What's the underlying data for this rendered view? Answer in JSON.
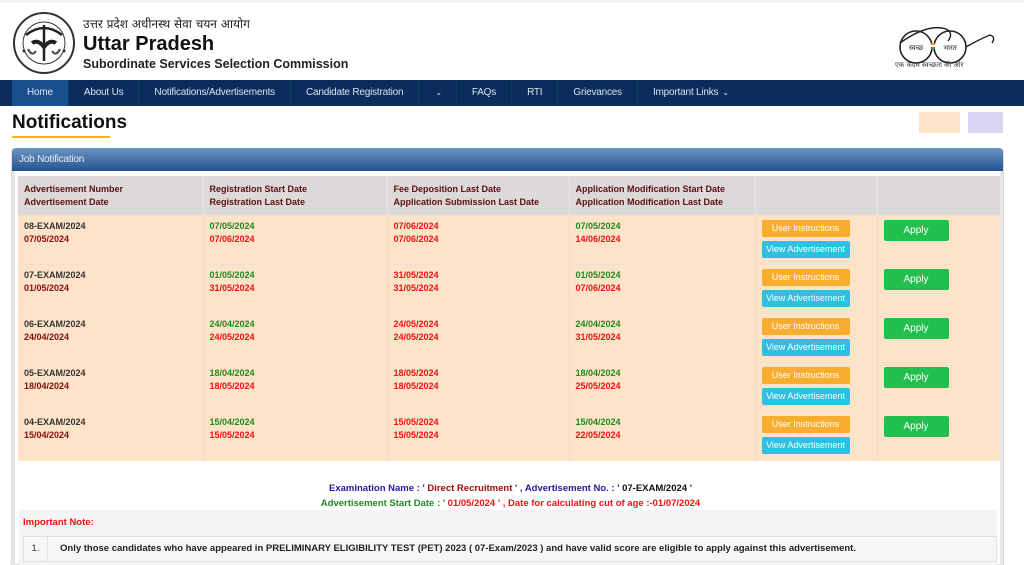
{
  "header": {
    "hindi_title": "उत्तर प्रदेश अधीनस्थ सेवा चयन आयोग",
    "title": "Uttar Pradesh",
    "subtitle": "Subordinate Services Selection Commission",
    "emblem_icon": "up-government-emblem",
    "swachh_logo": {
      "left_text": "स्वच्छ",
      "right_text": "भारत",
      "tagline": "एक कदम स्वच्छता की ओर"
    }
  },
  "nav": {
    "items": [
      {
        "label": "Home",
        "active": true
      },
      {
        "label": "About Us"
      },
      {
        "label": "Notifications/Advertisements"
      },
      {
        "label": "Candidate Registration"
      },
      {
        "label": "",
        "dropdown": true
      },
      {
        "label": "FAQs"
      },
      {
        "label": "RTI"
      },
      {
        "label": "Grievances"
      },
      {
        "label": "Important Links",
        "dropdown": true
      }
    ]
  },
  "page": {
    "title": "Notifications",
    "legend_colors": [
      "#fde3c8",
      "#d8d5f4"
    ]
  },
  "panel": {
    "title": "Job Notification",
    "columns": [
      {
        "line1": "Advertisement Number",
        "line2": "Advertisement Date"
      },
      {
        "line1": "Registration Start Date",
        "line2": "Registration Last Date"
      },
      {
        "line1": "Fee Deposition Last Date",
        "line2": "Application Submission Last Date"
      },
      {
        "line1": "Application Modification Start Date",
        "line2": "Application Modification Last Date"
      },
      {
        "line1": "",
        "line2": ""
      },
      {
        "line1": "",
        "line2": ""
      }
    ],
    "rows": [
      {
        "adv_no": "08-EXAM/2024",
        "adv_date": "07/05/2024",
        "reg_start": "07/05/2024",
        "reg_last": "07/06/2024",
        "fee_last": "07/06/2024",
        "submit_last": "07/06/2024",
        "mod_start": "07/05/2024",
        "mod_last": "14/06/2024"
      },
      {
        "adv_no": "07-EXAM/2024",
        "adv_date": "01/05/2024",
        "reg_start": "01/05/2024",
        "reg_last": "31/05/2024",
        "fee_last": "31/05/2024",
        "submit_last": "31/05/2024",
        "mod_start": "01/05/2024",
        "mod_last": "07/06/2024"
      },
      {
        "adv_no": "06-EXAM/2024",
        "adv_date": "24/04/2024",
        "reg_start": "24/04/2024",
        "reg_last": "24/05/2024",
        "fee_last": "24/05/2024",
        "submit_last": "24/05/2024",
        "mod_start": "24/04/2024",
        "mod_last": "31/05/2024"
      },
      {
        "adv_no": "05-EXAM/2024",
        "adv_date": "18/04/2024",
        "reg_start": "18/04/2024",
        "reg_last": "18/05/2024",
        "fee_last": "18/05/2024",
        "submit_last": "18/05/2024",
        "mod_start": "18/04/2024",
        "mod_last": "25/05/2024"
      },
      {
        "adv_no": "04-EXAM/2024",
        "adv_date": "15/04/2024",
        "reg_start": "15/04/2024",
        "reg_last": "15/05/2024",
        "fee_last": "15/05/2024",
        "submit_last": "15/05/2024",
        "mod_start": "15/04/2024",
        "mod_last": "22/05/2024"
      }
    ],
    "buttons": {
      "user_instructions": "User Instructions",
      "view_advertisement": "View Advertisement",
      "apply": "Apply"
    },
    "colors": {
      "row_bg": "#fde4c9",
      "header_bg": "#dcd9d8",
      "user_instructions_bg": "#f8ad2e",
      "view_advertisement_bg": "#2fbfe0",
      "apply_bg": "#22bf4f"
    }
  },
  "exam_info": {
    "exam_name_label": "Examination Name : '",
    "exam_name": " Direct Recruitment ",
    "adv_no_label": "' , Advertisement No. : '",
    "adv_no": " 07-EXAM/2024 ",
    "adv_no_close": "'",
    "start_date_label": "Advertisement Start Date : '",
    "start_date_value": " 01/05/2024 ' , Date for calculating cut of age :-01/07/2024"
  },
  "important_note": {
    "title": "Important Note:",
    "items": [
      {
        "num": "1.",
        "text": "Only those candidates who have appeared in PRELIMINARY ELIGIBILITY TEST (PET) 2023 ( 07-Exam/2023 ) and have valid score are eligible to apply against this advertisement."
      }
    ]
  }
}
